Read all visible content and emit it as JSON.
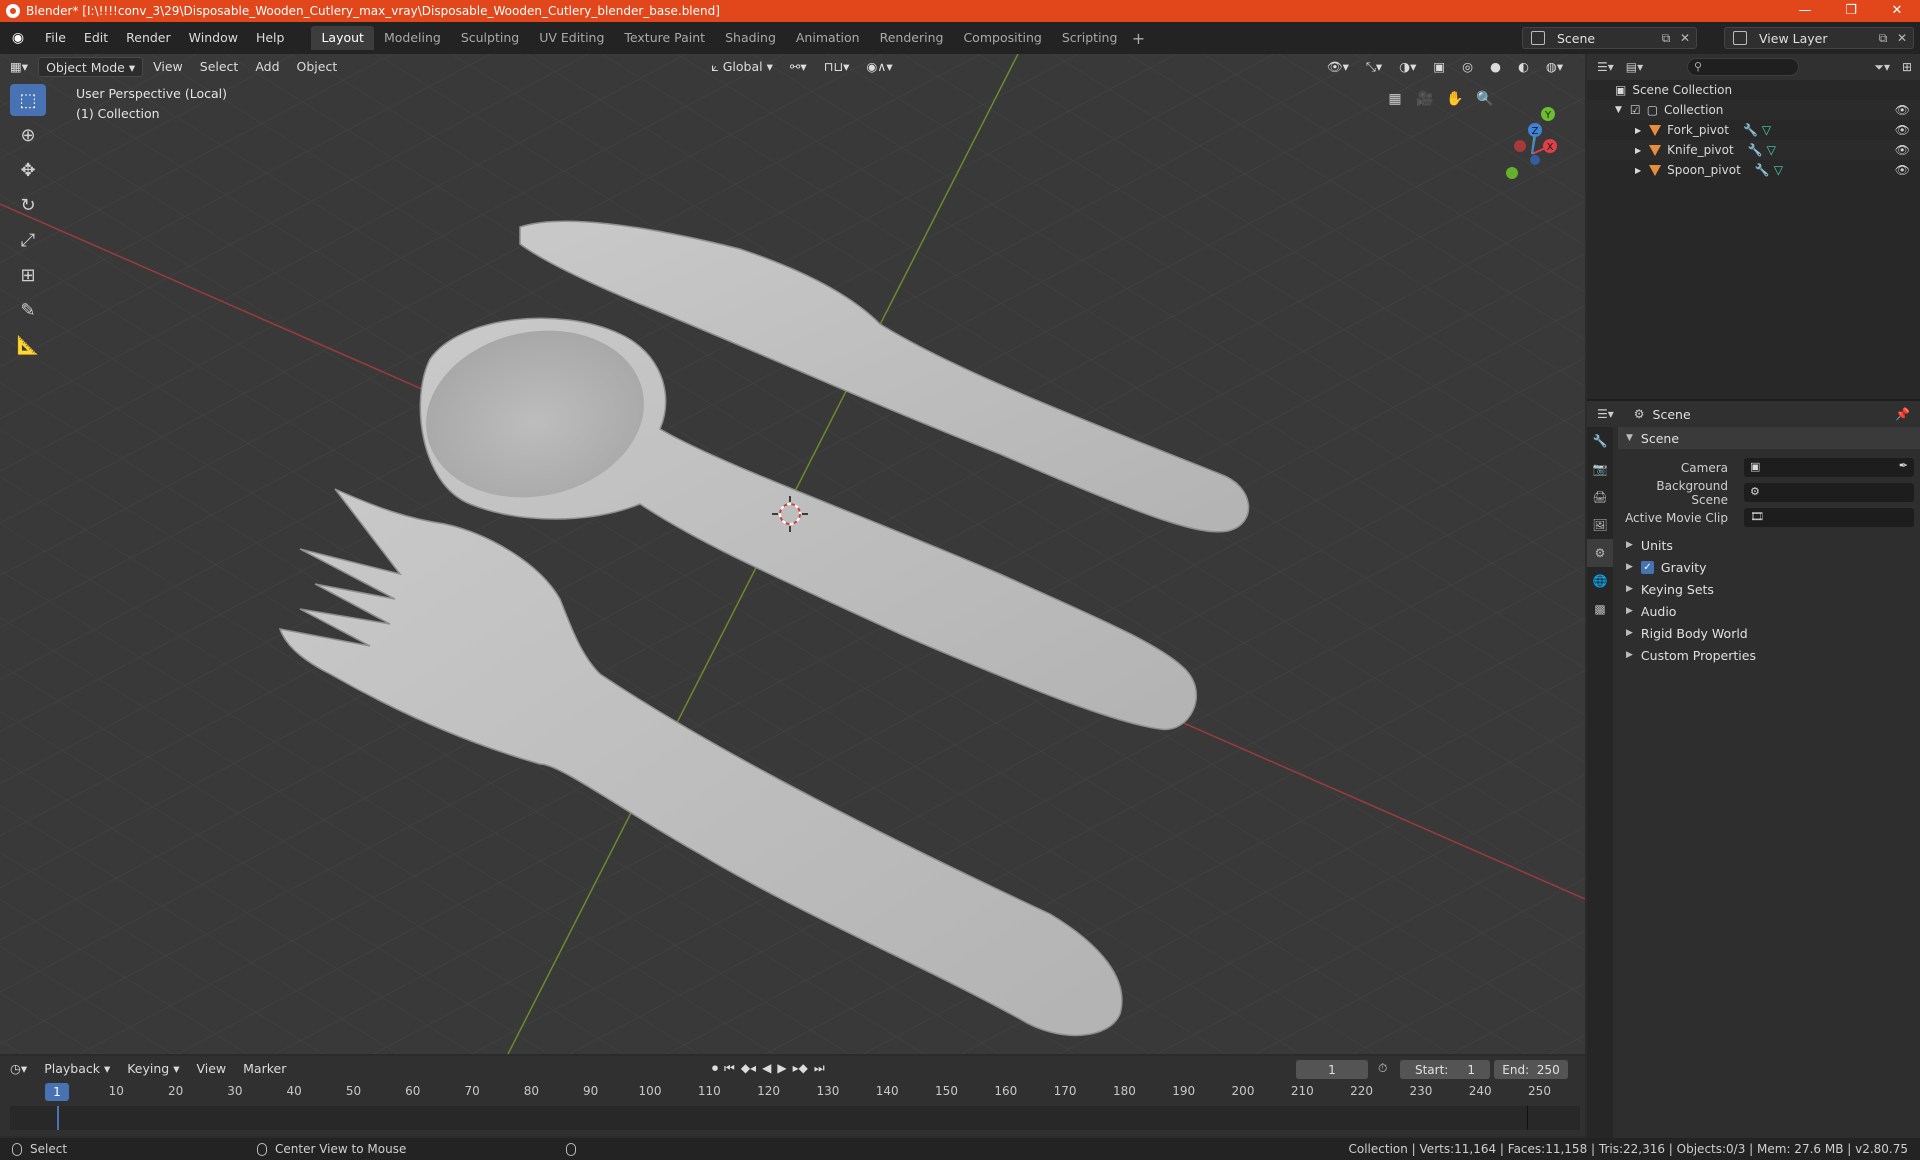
{
  "window": {
    "title": "Blender* [I:\\!!!!conv_3\\29\\Disposable_Wooden_Cutlery_max_vray\\Disposable_Wooden_Cutlery_blender_base.blend]",
    "minimize": "—",
    "restore": "❐",
    "close": "✕"
  },
  "menu": [
    "File",
    "Edit",
    "Render",
    "Window",
    "Help"
  ],
  "workspaces": [
    "Layout",
    "Modeling",
    "Sculpting",
    "UV Editing",
    "Texture Paint",
    "Shading",
    "Animation",
    "Rendering",
    "Compositing",
    "Scripting"
  ],
  "active_workspace": "Layout",
  "scene_selector": "Scene",
  "view_layer_selector": "View Layer",
  "viewport": {
    "mode": "Object Mode",
    "menus": [
      "View",
      "Select",
      "Add",
      "Object"
    ],
    "transform_orientation": "Global",
    "perspective_label": "User Perspective (Local)",
    "collection_label": "(1) Collection",
    "gizmo": {
      "x": "X",
      "y": "Y",
      "z": "Z"
    }
  },
  "outliner": {
    "root": "Scene Collection",
    "collection": "Collection",
    "objects": [
      "Fork_pivot",
      "Knife_pivot",
      "Spoon_pivot"
    ]
  },
  "properties": {
    "context": "Scene",
    "panel_title": "Scene",
    "fields": [
      {
        "label": "Camera"
      },
      {
        "label": "Background Scene"
      },
      {
        "label": "Active Movie Clip"
      }
    ],
    "panels": [
      "Units",
      "Gravity",
      "Keying Sets",
      "Audio",
      "Rigid Body World",
      "Custom Properties"
    ],
    "gravity_checked": true
  },
  "timeline": {
    "menus": [
      "Playback",
      "Keying",
      "View",
      "Marker"
    ],
    "current_frame": "1",
    "start_label": "Start:",
    "start": "1",
    "end_label": "End:",
    "end": "250",
    "ruler": [
      "10",
      "20",
      "30",
      "40",
      "50",
      "60",
      "70",
      "80",
      "90",
      "100",
      "110",
      "120",
      "130",
      "140",
      "150",
      "160",
      "170",
      "180",
      "190",
      "200",
      "210",
      "220",
      "230",
      "240",
      "250"
    ],
    "frame_marker": "1"
  },
  "status": {
    "left_action": "Select",
    "middle_action": "Center View to Mouse",
    "stats": "Collection | Verts:11,164 | Faces:11,158 | Tris:22,316 | Objects:0/3 | Mem: 27.6 MB | v2.80.75"
  }
}
